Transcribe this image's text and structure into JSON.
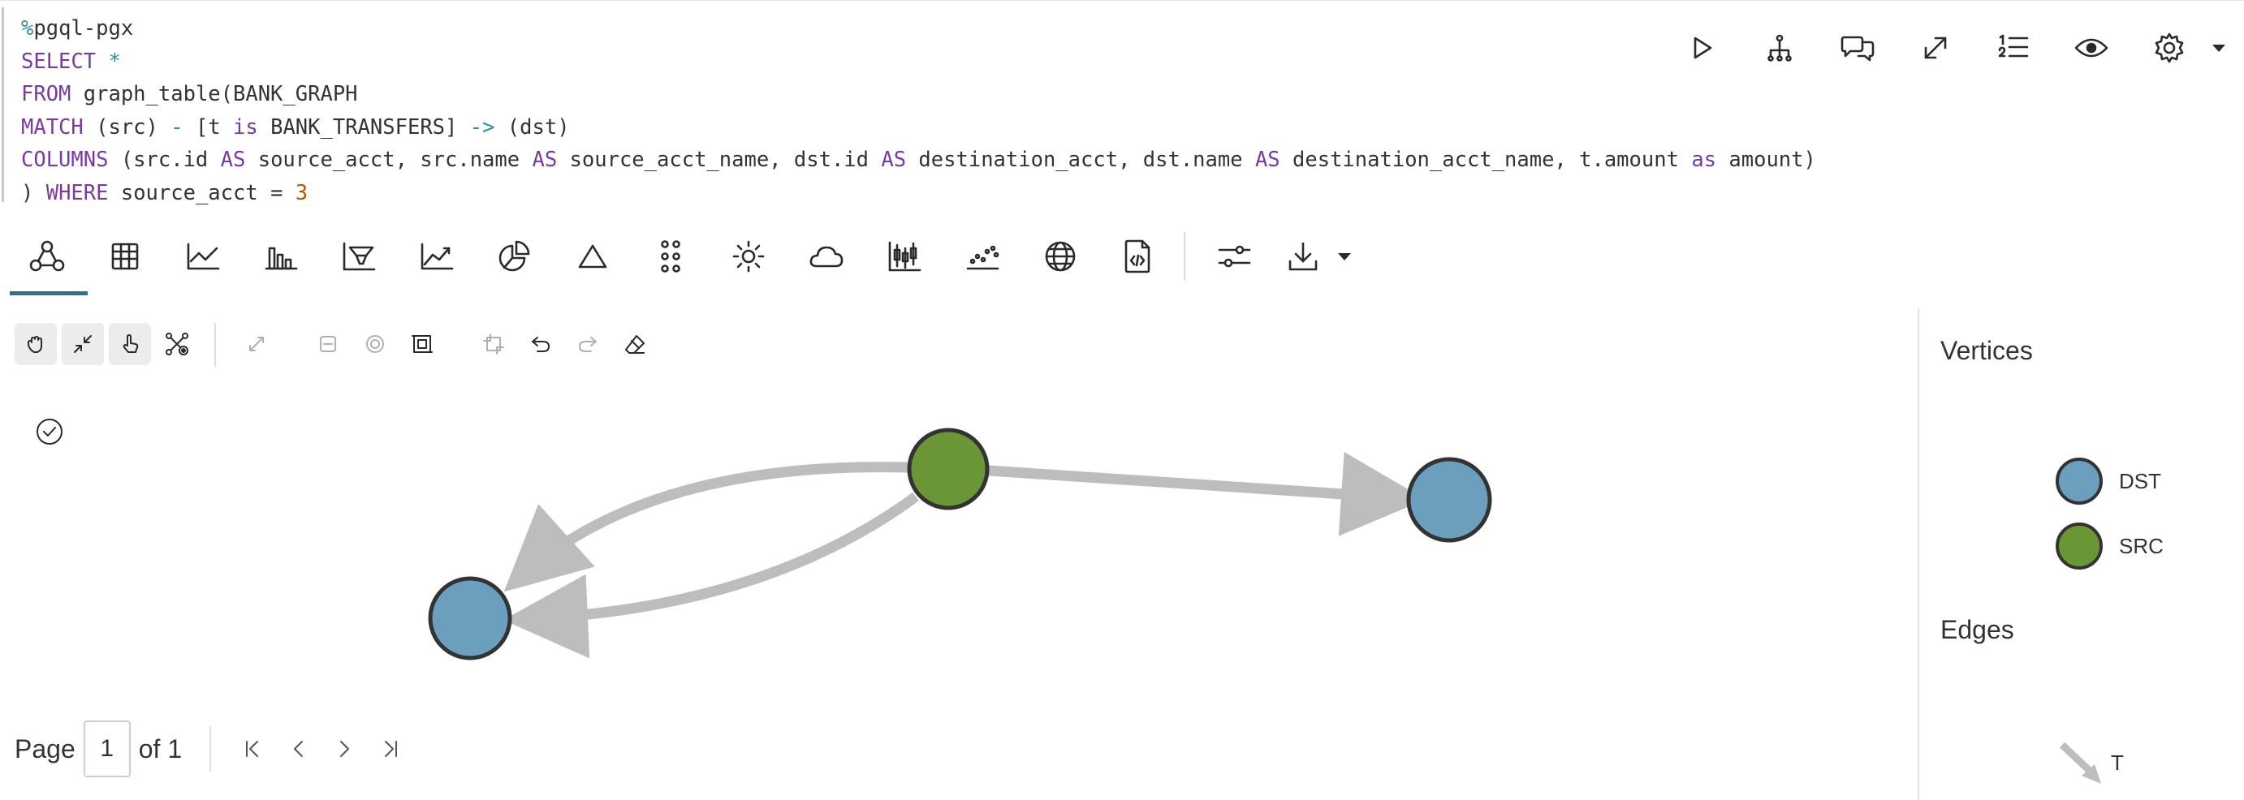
{
  "code": {
    "magic_pct": "%",
    "magic": "pgql-pgx",
    "lines": [
      {
        "k1": "SELECT",
        "rest": " *"
      },
      {
        "k1": "FROM",
        "rest": " graph_table(BANK_GRAPH"
      },
      {
        "k1": "MATCH",
        "rest": " (src) "
      },
      {
        "k1": "COLUMNS",
        "rest": " (src.id "
      },
      {
        "k1": ") WHERE",
        "rest": " source_acct = "
      }
    ],
    "match_line": {
      "start": "MATCH",
      "src": " (src) ",
      "op1": "-",
      "mid1": " [t ",
      "is": "is",
      "mid2": " BANK_TRANSFERS] ",
      "op2": "->",
      "end": " (dst)"
    },
    "columns_line": {
      "start": "COLUMNS",
      "p1": " (src.id ",
      "as1": "AS",
      "p2": " source_acct, src.name ",
      "as2": "AS",
      "p3": " source_acct_name, dst.id ",
      "as3": "AS",
      "p4": " destination_acct, dst.name ",
      "as4": "AS",
      "p5": " destination_acct_name, t.amount ",
      "as5": "as",
      "p6": " amount)"
    },
    "where_line": {
      "start": ") ",
      "where": "WHERE",
      "mid": " source_acct = ",
      "num": "3"
    }
  },
  "top_toolbar": {
    "icons": [
      "run-icon",
      "hierarchy-icon",
      "comments-icon",
      "expand-icon",
      "numbered-list-icon",
      "eye-icon",
      "gear-icon",
      "caret-down-icon"
    ]
  },
  "viz_tabs": {
    "active": "graph-icon",
    "icons": [
      "graph-icon",
      "table-icon",
      "line-chart-icon",
      "bar-chart-icon",
      "funnel-chart-icon",
      "area-chart-icon",
      "pie-chart-icon",
      "pyramid-icon",
      "dot-grid-icon",
      "sun-icon",
      "cloud-icon",
      "candlestick-icon",
      "scatter-icon",
      "globe-icon",
      "code-file-icon",
      "settings-sliders-icon",
      "download-icon",
      "caret-down-icon"
    ]
  },
  "graph_tools": {
    "icons": [
      "pan-icon",
      "fit-icon",
      "select-hand-icon",
      "graph-layout-icon",
      "expand-icon",
      "collapse-icon",
      "focus-icon",
      "frame-icon",
      "group-icon",
      "undo-icon",
      "redo-icon",
      "eraser-icon"
    ]
  },
  "graph": {
    "colors": {
      "dst": "#6b9fbd",
      "src": "#6a9636",
      "edge": "#bdbdbd",
      "stroke": "#333333"
    },
    "nodes": [
      {
        "id": "src-node",
        "label": "SRC"
      },
      {
        "id": "dst-node-1",
        "label": "DST"
      },
      {
        "id": "dst-node-2",
        "label": "DST"
      }
    ],
    "edges": [
      {
        "from": "src-node",
        "to": "dst-node-1",
        "label": "T"
      },
      {
        "from": "src-node",
        "to": "dst-node-2",
        "label": "T"
      },
      {
        "from": "src-node",
        "to": "dst-node-2",
        "label": "T"
      }
    ]
  },
  "pager": {
    "page_label": "Page",
    "page_value": "1",
    "of_label": "of 1"
  },
  "legend": {
    "vertices_title": "Vertices",
    "edges_title": "Edges",
    "vertices": [
      {
        "label": "DST",
        "color": "#6b9fbd"
      },
      {
        "label": "SRC",
        "color": "#6a9636"
      }
    ],
    "edges": [
      {
        "label": "T",
        "color": "#bdbdbd"
      }
    ]
  }
}
